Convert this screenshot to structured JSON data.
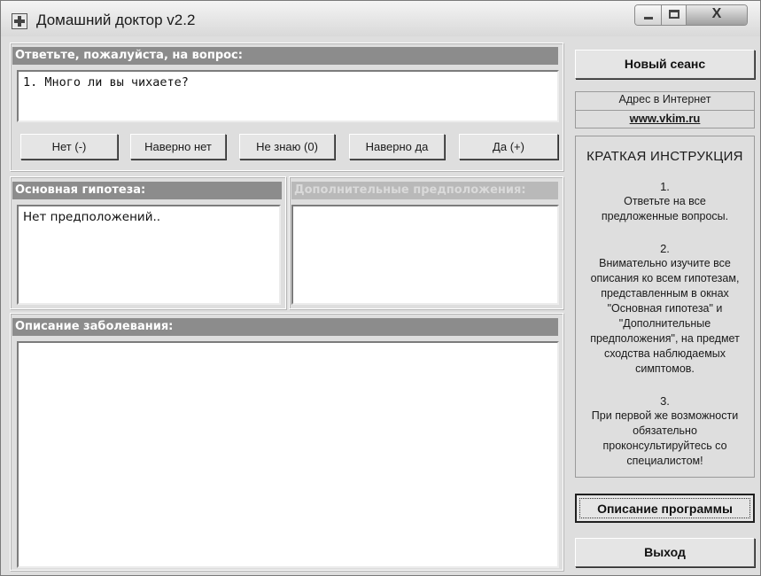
{
  "window": {
    "title": "Домашний доктор v2.2",
    "close_glyph": "X"
  },
  "question": {
    "header": "Ответьте, пожалуйста, на вопрос:",
    "text": "1.  Много ли вы чихаете?"
  },
  "answers": [
    {
      "label": "Нет (-)"
    },
    {
      "label": "Наверно нет"
    },
    {
      "label": "Не знаю (0)"
    },
    {
      "label": "Наверно да"
    },
    {
      "label": "Да (+)"
    }
  ],
  "hypothesis": {
    "main_header": "Основная гипотеза:",
    "main_text": "Нет предположений..",
    "extra_header": "Дополнительные предположения:",
    "extra_text": ""
  },
  "description": {
    "header": "Описание заболевания:",
    "text": ""
  },
  "sidebar": {
    "new_session": "Новый сеанс",
    "address_label": "Адрес в Интернет",
    "address_link": "www.vkim.ru",
    "instructions_title": "КРАТКАЯ ИНСТРУКЦИЯ",
    "steps": [
      {
        "num": "1.",
        "text": "Ответьте на все\nпредложенные вопросы."
      },
      {
        "num": "2.",
        "text": "Внимательно изучите все\nописания ко всем гипотезам,\nпредставленным в окнах\n\"Основная гипотеза\" и\n\"Дополнительные\nпредположения\", на предмет\nсходства наблюдаемых\nсимптомов."
      },
      {
        "num": "3.",
        "text": "При первой же возможности\nобязательно\nпроконсультируйтесь со\nспециалистом!"
      }
    ],
    "about": "Описание программы",
    "exit": "Выход"
  }
}
